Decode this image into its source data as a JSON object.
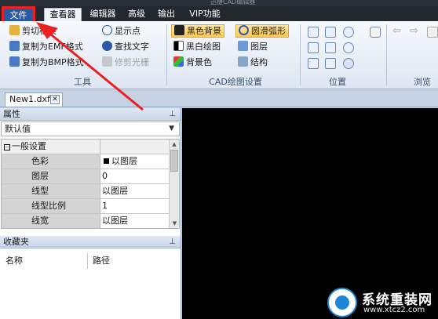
{
  "window": {
    "title": "迅捷CAD编辑器"
  },
  "menu": {
    "tabs": [
      "文件",
      "查看器",
      "编辑器",
      "高级",
      "输出",
      "VIP功能"
    ],
    "active_tab": "查看器"
  },
  "ribbon": {
    "tools_group": {
      "label": "工具",
      "buttons": [
        "剪切框架",
        "复制为EMF格式",
        "复制为BMP格式",
        "显示点",
        "查找文字",
        "修剪光栅"
      ]
    },
    "cad_group": {
      "label": "CAD绘图设置",
      "buttons": [
        "黑色背景",
        "圆滑弧形",
        "黑白绘图",
        "图层",
        "背景色",
        "结构"
      ]
    },
    "position_group": {
      "label": "位置"
    },
    "browse_group": {
      "label": "浏览"
    }
  },
  "document": {
    "tab_label": "New1.dxf"
  },
  "properties": {
    "title": "属性",
    "combo_value": "默认值",
    "category": "一般设置",
    "rows": [
      {
        "key": "色彩",
        "value": "以图层"
      },
      {
        "key": "图层",
        "value": "0"
      },
      {
        "key": "线型",
        "value": "以图层"
      },
      {
        "key": "线型比例",
        "value": "1"
      },
      {
        "key": "线宽",
        "value": "以图层"
      }
    ]
  },
  "favorites": {
    "title": "收藏夹",
    "columns": [
      "名称",
      "路径"
    ]
  },
  "watermark": {
    "name": "系统重装网",
    "url": "www.xtcz2.com"
  },
  "colors": {
    "file_tab": "#2b5aa5",
    "annotation": "#ec2020",
    "canvas": "#000000"
  }
}
